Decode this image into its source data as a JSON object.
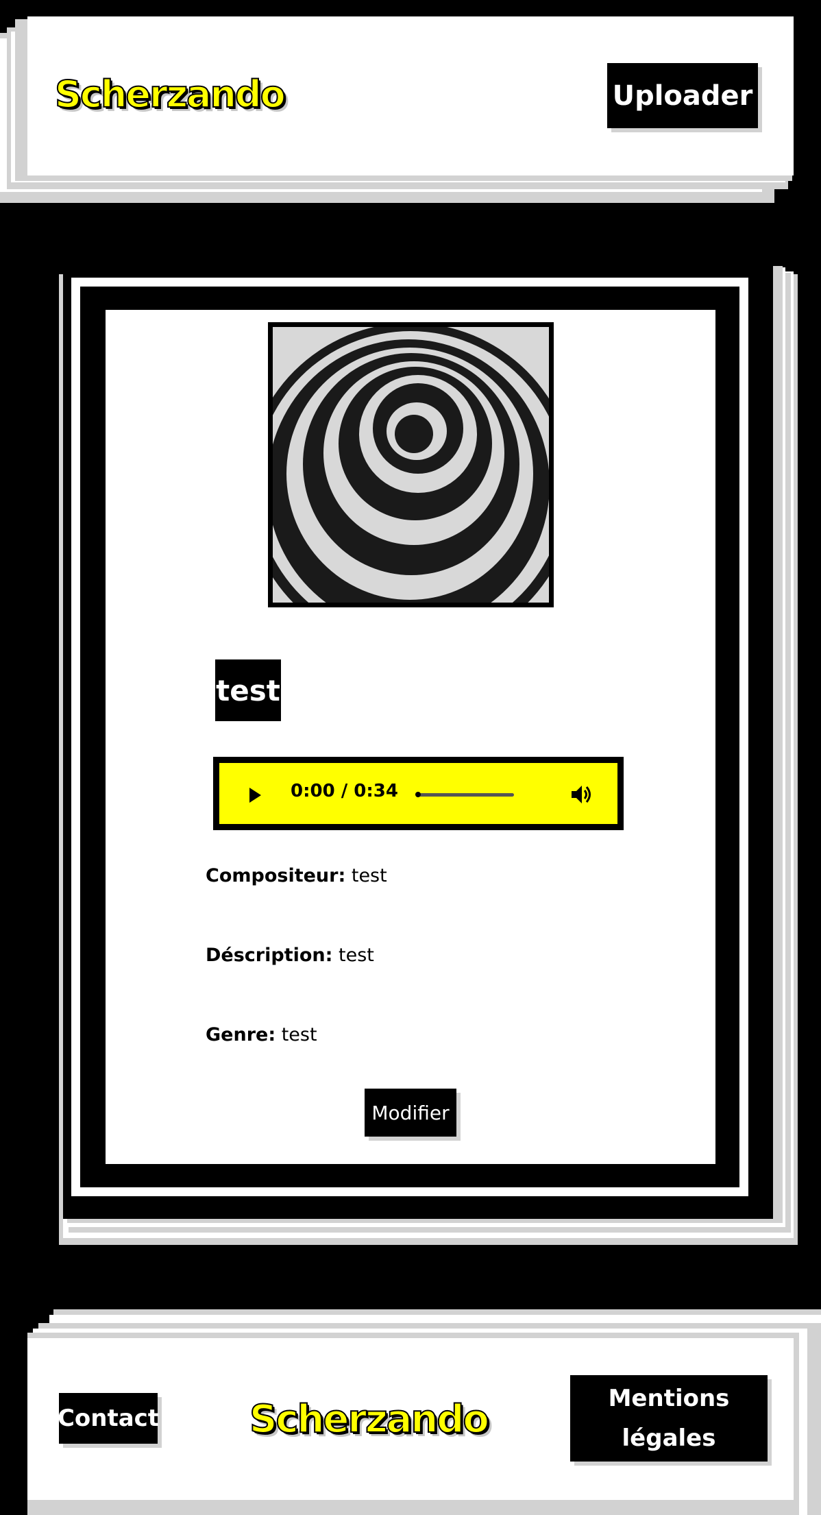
{
  "header": {
    "logo": "Scherzando",
    "upload_label": "Uploader"
  },
  "track": {
    "title": "test",
    "cover_alt": "spiral cover art",
    "player": {
      "current_time": "0:00",
      "separator": "/",
      "duration": "0:34",
      "progress": 0.0
    },
    "fields": [
      {
        "label": "Compositeur:",
        "value": "test"
      },
      {
        "label": "Déscription:",
        "value": "test"
      },
      {
        "label": "Genre:",
        "value": "test"
      }
    ],
    "edit_label": "Modifier"
  },
  "footer": {
    "contact_label": "Contact",
    "logo": "Scherzando",
    "legal_label_line1": "Mentions",
    "legal_label_line2": "légales"
  },
  "colors": {
    "accent": "#ffff00",
    "background": "#000000",
    "panel": "#ffffff",
    "shadow": "#d2d2d2"
  }
}
